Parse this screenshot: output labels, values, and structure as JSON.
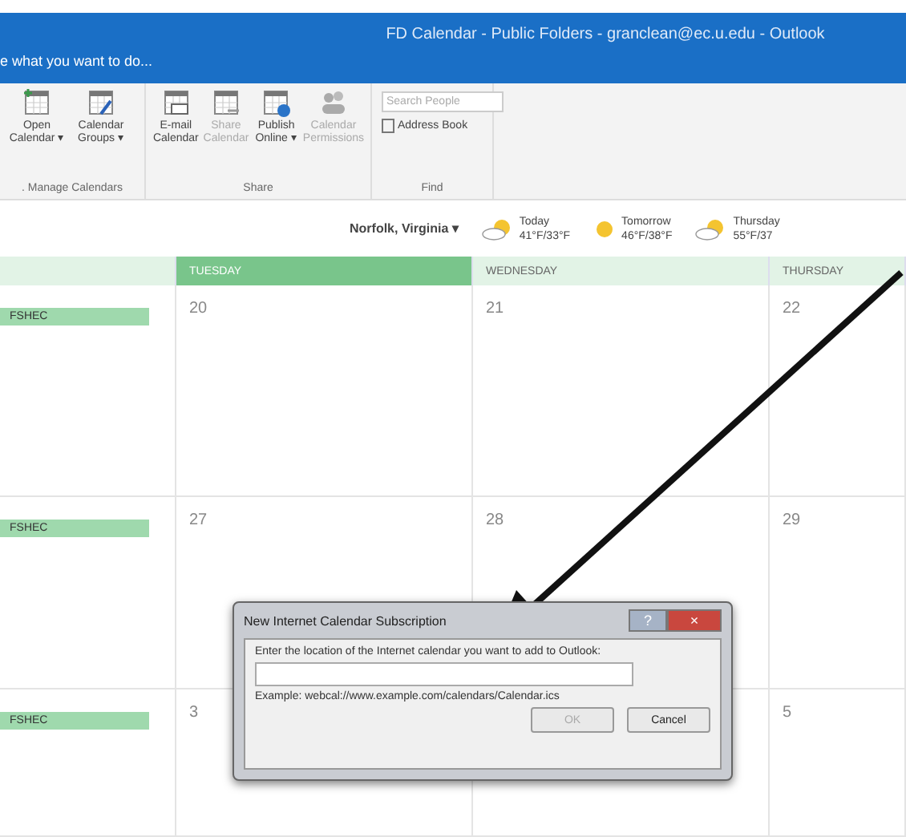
{
  "window": {
    "title": "FD Calendar - Public Folders - granclean@ec.u.edu - Outlook"
  },
  "tell_me": {
    "placeholder": "e what you want to do..."
  },
  "ribbon": {
    "groups": [
      {
        "label": ". Manage Calendars",
        "buttons": [
          {
            "label": "Open Calendar ▾",
            "kind": "add",
            "disabled": false
          },
          {
            "label": "Calendar Groups ▾",
            "kind": "edit",
            "disabled": false
          }
        ]
      },
      {
        "label": "Share",
        "buttons": [
          {
            "label": "E-mail Calendar",
            "kind": "mail",
            "disabled": false
          },
          {
            "label": "Share Calendar",
            "kind": "share",
            "disabled": true
          },
          {
            "label": "Publish Online ▾",
            "kind": "globe",
            "disabled": false
          },
          {
            "label": "Calendar Permissions",
            "kind": "people",
            "disabled": true
          }
        ]
      },
      {
        "label": "Find",
        "kind": "find",
        "search": {
          "placeholder": "Search People"
        },
        "address_book": "Address Book"
      }
    ]
  },
  "weather": {
    "location": "Norfolk, Virginia ▾",
    "days": [
      {
        "label": "Today",
        "temps": "41°F/33°F",
        "kind": "cloudy"
      },
      {
        "label": "Tomorrow",
        "temps": "46°F/38°F",
        "kind": "sunny"
      },
      {
        "label": "Thursday",
        "temps": "55°F/37",
        "kind": "cloudy"
      }
    ]
  },
  "calendar": {
    "columns": [
      {
        "selected": false
      },
      {
        "label": "TUESDAY",
        "selected": true
      },
      {
        "label": "WEDNESDAY",
        "selected": false
      },
      {
        "label": "THURSDAY",
        "selected": false
      }
    ],
    "weeks": [
      {
        "cells": [
          {
            "event": "FSHEC"
          },
          {
            "date": "20"
          },
          {
            "date": "21"
          },
          {
            "date": "22"
          }
        ]
      },
      {
        "cells": [
          {
            "event": "FSHEC"
          },
          {
            "date": "27"
          },
          {
            "date": "28"
          },
          {
            "date": "29"
          }
        ]
      },
      {
        "cells": [
          {
            "event": "FSHEC"
          },
          {
            "date": "3"
          },
          {},
          {
            "date": "5"
          }
        ]
      }
    ]
  },
  "dialog": {
    "title": "New Internet Calendar Subscription",
    "help": "?",
    "close": "×",
    "prompt": "Enter the location of the Internet calendar you want to add to Outlook:",
    "example": "Example: webcal://www.example.com/calendars/Calendar.ics",
    "buttons": [
      {
        "label": "OK",
        "disabled": true
      },
      {
        "label": "Cancel",
        "disabled": false
      }
    ]
  }
}
